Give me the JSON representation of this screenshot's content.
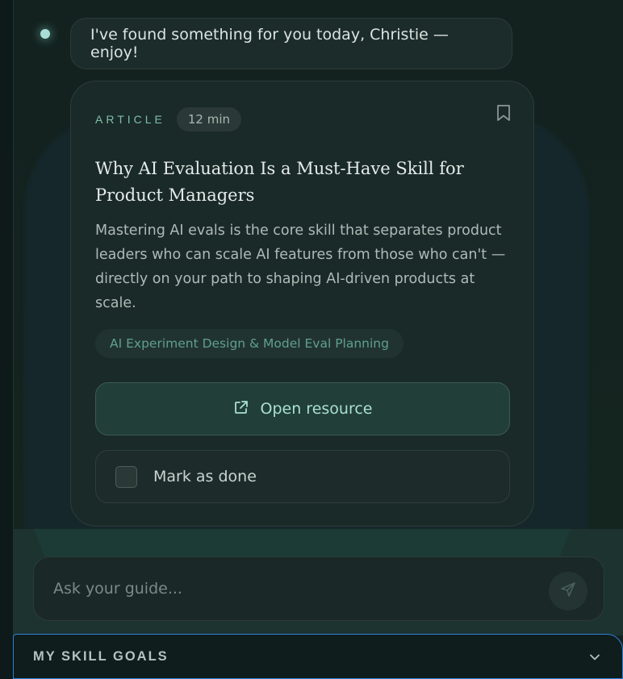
{
  "chat": {
    "greeting": "I've found something for you today, Christie — enjoy!"
  },
  "resource_card": {
    "kind": "ARTICLE",
    "duration": "12 min",
    "title": "Why AI Evaluation Is a Must-Have Skill for Product Managers",
    "description": "Mastering AI evals is the core skill that separates product leaders who can scale AI features from those who can't — directly on your path to shaping AI-driven products at scale.",
    "tag": "AI Experiment Design & Model Eval Planning",
    "open_label": "Open resource",
    "done_label": "Mark as done",
    "done_checked": false,
    "icons": {
      "bookmark": "bookmark-icon",
      "open": "external-link-icon"
    }
  },
  "composer": {
    "placeholder": "Ask your guide...",
    "send_icon": "send-icon"
  },
  "goals_panel": {
    "label": "MY SKILL GOALS",
    "toggle_icon": "chevron-down-icon"
  },
  "colors": {
    "accent": "#7fbfa8",
    "focus_ring": "#2f7fd8",
    "background": "#132220"
  }
}
